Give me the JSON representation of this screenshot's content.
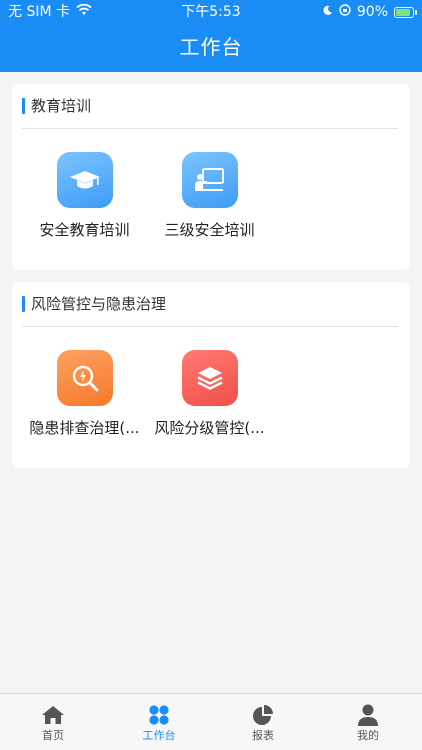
{
  "status_bar": {
    "carrier": "无 SIM 卡",
    "time": "下午5:53",
    "battery": "90%"
  },
  "header": {
    "title": "工作台"
  },
  "sections": [
    {
      "title": "教育培训",
      "items": [
        {
          "label": "安全教育培训",
          "icon": "graduation-cap-icon"
        },
        {
          "label": "三级安全培训",
          "icon": "blackboard-teacher-icon"
        }
      ]
    },
    {
      "title": "风险管控与隐患治理",
      "items": [
        {
          "label": "隐患排查治理(...",
          "icon": "search-hazard-icon"
        },
        {
          "label": "风险分级管控(...",
          "icon": "layers-icon"
        }
      ]
    }
  ],
  "tabbar": {
    "items": [
      {
        "label": "首页",
        "icon": "home-icon"
      },
      {
        "label": "工作台",
        "icon": "grid-icon"
      },
      {
        "label": "报表",
        "icon": "pie-chart-icon"
      },
      {
        "label": "我的",
        "icon": "user-icon"
      }
    ],
    "active": "工作台"
  },
  "colors": {
    "primary": "#1a8cf5",
    "tab_inactive": "#555555",
    "background": "#f3f4f6"
  }
}
